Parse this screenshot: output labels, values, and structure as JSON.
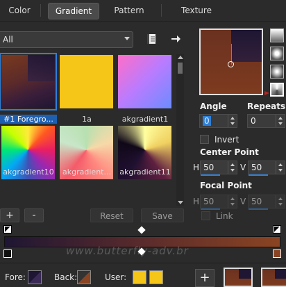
{
  "tabs": [
    {
      "label": "Color"
    },
    {
      "label": "Gradient"
    },
    {
      "label": "Pattern"
    },
    {
      "label": "Texture"
    }
  ],
  "category": {
    "value": "All"
  },
  "gradients": [
    {
      "label": "#1 Foregro...",
      "selected": true
    },
    {
      "label": "1a",
      "selected": false
    },
    {
      "label": "akgradient1",
      "selected": false
    },
    {
      "label": "akgradient10",
      "selected": false
    },
    {
      "label": "akgradient...",
      "selected": false
    },
    {
      "label": "akgradient11",
      "selected": false
    }
  ],
  "list_buttons": {
    "add": "+",
    "remove": "-",
    "reset": "Reset",
    "save": "Save"
  },
  "angle": {
    "label": "Angle",
    "value": "0"
  },
  "repeats": {
    "label": "Repeats",
    "value": "0"
  },
  "invert": {
    "label": "Invert"
  },
  "center_point": {
    "label": "Center Point",
    "h_label": "H",
    "h_value": "50",
    "v_label": "V",
    "v_value": "50"
  },
  "focal_point": {
    "label": "Focal Point",
    "h_label": "H",
    "h_value": "50",
    "v_label": "V",
    "v_value": "50"
  },
  "link": {
    "label": "Link"
  },
  "bottom": {
    "fore_label": "Fore:",
    "back_label": "Back:",
    "user_label": "User:",
    "add": "+"
  },
  "watermark": "www.butterfly-adv.br",
  "colors": {
    "accent": "#2e7fd8",
    "fore": "#1e1633",
    "back": "#8b4422",
    "user": "#f5c518"
  }
}
